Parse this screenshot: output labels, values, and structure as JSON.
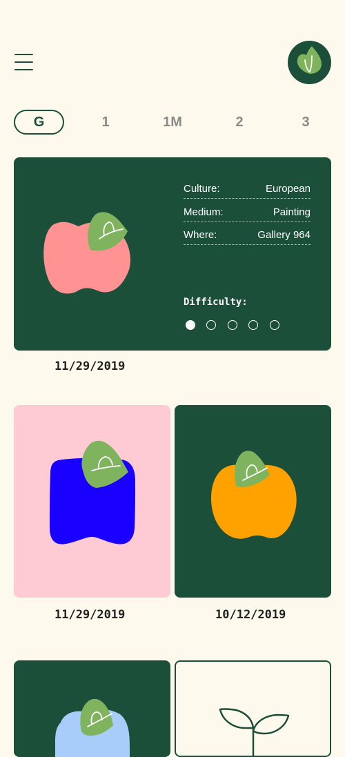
{
  "header": {
    "menu_icon": "hamburger-menu-icon",
    "logo_icon": "leaf-logo-icon"
  },
  "filters": {
    "active": "G",
    "tabs": [
      {
        "label": "G"
      },
      {
        "label": "1"
      },
      {
        "label": "1M"
      },
      {
        "label": "2"
      },
      {
        "label": "3"
      }
    ]
  },
  "featured": {
    "art_icon": "pink-apple-icon",
    "details": [
      {
        "key": "Culture:",
        "value": "European"
      },
      {
        "key": "Medium:",
        "value": "Painting"
      },
      {
        "key": "Where:",
        "value": "Gallery 964"
      }
    ],
    "difficulty_label": "Difficulty:",
    "difficulty": {
      "level": 1,
      "max": 5
    },
    "date": "11/29/2019"
  },
  "grid": [
    {
      "art_icon": "blue-square-fruit-icon",
      "background": "#fecbd4",
      "fruit_color": "#1a00ff",
      "date": "11/29/2019"
    },
    {
      "art_icon": "orange-apple-icon",
      "background": "#1b4f3a",
      "fruit_color": "#ffa200",
      "date": "10/12/2019"
    },
    {
      "art_icon": "light-blue-fruit-icon",
      "background": "#1b4f3a",
      "fruit_color": "#a9cdfa",
      "date": ""
    },
    {
      "art_icon": "sprout-icon",
      "background": "#fdf9ec",
      "fruit_color": "",
      "date": ""
    }
  ],
  "colors": {
    "primary": "#1b4f3a",
    "leaf": "#7fb35d",
    "background": "#fdf9ec",
    "pink_apple": "#ff9393"
  }
}
